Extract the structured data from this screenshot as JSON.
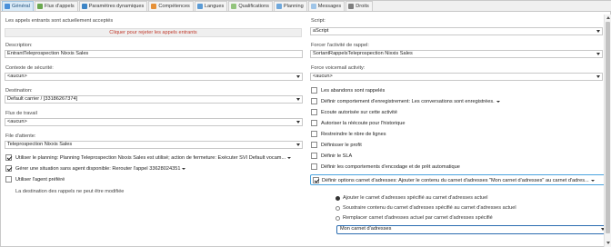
{
  "tabs": [
    {
      "label": "Général",
      "icon": "general-icon",
      "active": true
    },
    {
      "label": "Flux d'appels",
      "icon": "flow-icon"
    },
    {
      "label": "Paramètres dynamiques",
      "icon": "dynamic-params-icon"
    },
    {
      "label": "Compétences",
      "icon": "skills-icon"
    },
    {
      "label": "Langues",
      "icon": "languages-icon"
    },
    {
      "label": "Qualifications",
      "icon": "qualifications-icon"
    },
    {
      "label": "Planning",
      "icon": "planning-icon"
    },
    {
      "label": "Messages",
      "icon": "messages-icon"
    },
    {
      "label": "Droits",
      "icon": "rights-icon"
    }
  ],
  "left": {
    "calls_status": "Les appels entrants sont actuellement acceptés",
    "reject_link": "Cliquer pour rejeter les appels entrants",
    "description": {
      "label": "Description:",
      "value": "EntrantTeleprospection Nixxis Sales"
    },
    "security": {
      "label": "Contexte de sécurité:",
      "value": "<aucun>"
    },
    "destination": {
      "label": "Destination:",
      "value": "Default carrier / [33186267374]"
    },
    "flux_travail": {
      "label": "Flux de travail",
      "value": "<aucun>"
    },
    "file_attente": {
      "label": "File d'attente:",
      "value": "Teleprospection Nixxis Sales"
    },
    "checks": [
      {
        "text": "Utiliser le planning: Planning Teleprospection Nixxis Sales est utilisé; action de fermeture: Exécuter SVI Default vocam...",
        "checked": true,
        "dropdown": true
      },
      {
        "text": "Gérer une situation sans agent disponible: Rerouter l'appel 33628024351",
        "checked": true,
        "dropdown": true
      },
      {
        "text": "Utiliser l'agent préféré",
        "checked": false,
        "dropdown": false
      }
    ],
    "note": "La destination des rappels ne peut être modifiée"
  },
  "right": {
    "script": {
      "label": "Script:",
      "value": "aScript"
    },
    "forcer": {
      "label": "Forcer l'activité de rappel:",
      "value": "SortantRappelsTeleprospection Nixxis Sales"
    },
    "voicemail": {
      "label": "Force voicemail activity:",
      "value": "<aucun>"
    },
    "checks": [
      {
        "text": "Les abandons sont rappelés",
        "checked": false,
        "dropdown": false
      },
      {
        "text": "Définir comportement d'enregistrement: Les conversations sont enregistrées.",
        "checked": false,
        "dropdown": true
      },
      {
        "text": "Ecoute autorisée sur cette activité",
        "checked": false,
        "dropdown": false
      },
      {
        "text": "Autoriser la réécoute pour l'historique",
        "checked": false,
        "dropdown": false
      },
      {
        "text": "Restreindre le nbre de lignes",
        "checked": false,
        "dropdown": false
      },
      {
        "text": "Définisser le profit",
        "checked": false,
        "dropdown": false
      },
      {
        "text": "Définir le SLA",
        "checked": false,
        "dropdown": false
      },
      {
        "text": "Définir les comportements d'encodage et de prêt automatique",
        "checked": false,
        "dropdown": false
      },
      {
        "text": "Définir options carnet d'adresses: Ajouter le contenu du carnet d'adresses \"Mon carnet d'adresses\" au carnet d'adres...",
        "checked": true,
        "dropdown": true
      }
    ],
    "radios": [
      {
        "text": "Ajouter le carnet d'adresses spécifié au carnet d'adresses actuel",
        "selected": true
      },
      {
        "text": "Soustraire contenu du carnet d'adresses spécifié au carnet d'adresses actuel",
        "selected": false
      },
      {
        "text": "Remplacer carnet d'adresses actuel par carnet d'adresses spécifié",
        "selected": false
      }
    ],
    "address_book": "Mon carnet d'adresses"
  },
  "colors": {
    "accent": "#4aa3df",
    "link_red": "#c0392b",
    "tab_active": "#d9eaf7"
  }
}
